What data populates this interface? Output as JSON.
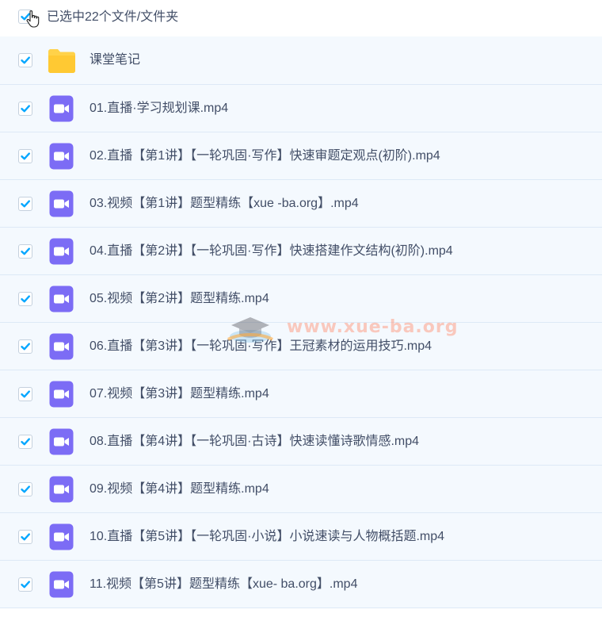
{
  "header": {
    "selection_label": "已选中22个文件/文件夹"
  },
  "files": [
    {
      "name": "课堂笔记",
      "type": "folder",
      "icon": "folder-icon"
    },
    {
      "name": "01.直播·学习规划课.mp4",
      "type": "video",
      "icon": "video-file-icon"
    },
    {
      "name": "02.直播【第1讲】【一轮巩固·写作】快速审题定观点(初阶).mp4",
      "type": "video",
      "icon": "video-file-icon"
    },
    {
      "name": "03.视频【第1讲】题型精练【xue -ba.org】.mp4",
      "type": "video",
      "icon": "video-file-icon"
    },
    {
      "name": "04.直播【第2讲】【一轮巩固·写作】快速搭建作文结构(初阶).mp4",
      "type": "video",
      "icon": "video-file-icon"
    },
    {
      "name": "05.视频【第2讲】题型精练.mp4",
      "type": "video",
      "icon": "video-file-icon"
    },
    {
      "name": "06.直播【第3讲】【一轮巩固·写作】王冠素材的运用技巧.mp4",
      "type": "video",
      "icon": "video-file-icon"
    },
    {
      "name": "07.视频【第3讲】题型精练.mp4",
      "type": "video",
      "icon": "video-file-icon"
    },
    {
      "name": "08.直播【第4讲】【一轮巩固·古诗】快速读懂诗歌情感.mp4",
      "type": "video",
      "icon": "video-file-icon"
    },
    {
      "name": "09.视频【第4讲】题型精练.mp4",
      "type": "video",
      "icon": "video-file-icon"
    },
    {
      "name": "10.直播【第5讲】【一轮巩固·小说】小说速读与人物概括题.mp4",
      "type": "video",
      "icon": "video-file-icon"
    },
    {
      "name": "11.视频【第5讲】题型精练【xue- ba.org】.mp4",
      "type": "video",
      "icon": "video-file-icon"
    }
  ],
  "watermark": {
    "text": "www.xue-ba.org"
  },
  "colors": {
    "checkbox_check": "#06a7ff",
    "row_background": "#f4f9fe",
    "row_divider": "#dde9f6",
    "text": "#424e67",
    "folder": "#ffd249",
    "video_icon": "#7c6cf5"
  }
}
